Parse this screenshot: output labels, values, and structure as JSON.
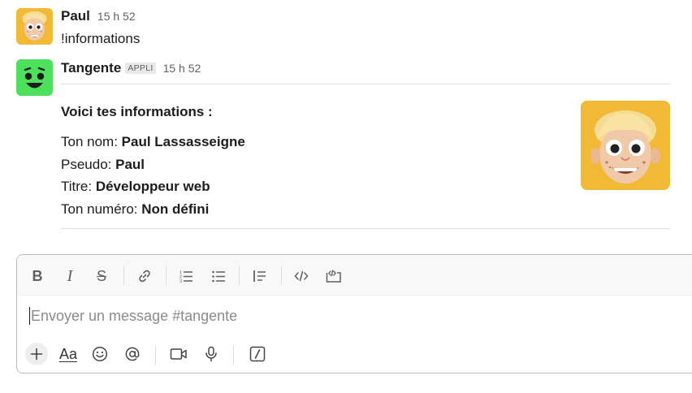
{
  "messages": [
    {
      "author": "Paul",
      "time": "15 h 52",
      "text": "!informations",
      "avatar_icon": "paul-avatar-icon"
    },
    {
      "author": "Tangente",
      "badge": "APPLI",
      "time": "15 h 52",
      "avatar_icon": "tangente-bot-avatar-icon",
      "card": {
        "title": "Voici tes informations :",
        "fields": [
          {
            "label": "Ton nom: ",
            "value": "Paul Lassasseigne"
          },
          {
            "label": "Pseudo: ",
            "value": "Paul"
          },
          {
            "label": "Titre: ",
            "value": "Développeur web"
          },
          {
            "label": "Ton numéro: ",
            "value": "Non défini"
          }
        ],
        "image_icon": "paul-profile-image"
      }
    }
  ],
  "composer": {
    "placeholder": "Envoyer un message #tangente",
    "toolbar": [
      "bold-icon",
      "italic-icon",
      "strikethrough-icon",
      "link-icon",
      "ordered-list-icon",
      "bulleted-list-icon",
      "blockquote-icon",
      "code-icon",
      "code-block-icon"
    ],
    "bottom": [
      "plus-icon",
      "formatting-icon",
      "emoji-icon",
      "mention-icon",
      "video-icon",
      "microphone-icon",
      "slash-command-icon"
    ],
    "formatting_label": "Aa"
  },
  "colors": {
    "text": "#1d1c1d",
    "muted": "#616061",
    "avatar_yellow": "#f1b935",
    "bot_green": "#4ce05c"
  }
}
